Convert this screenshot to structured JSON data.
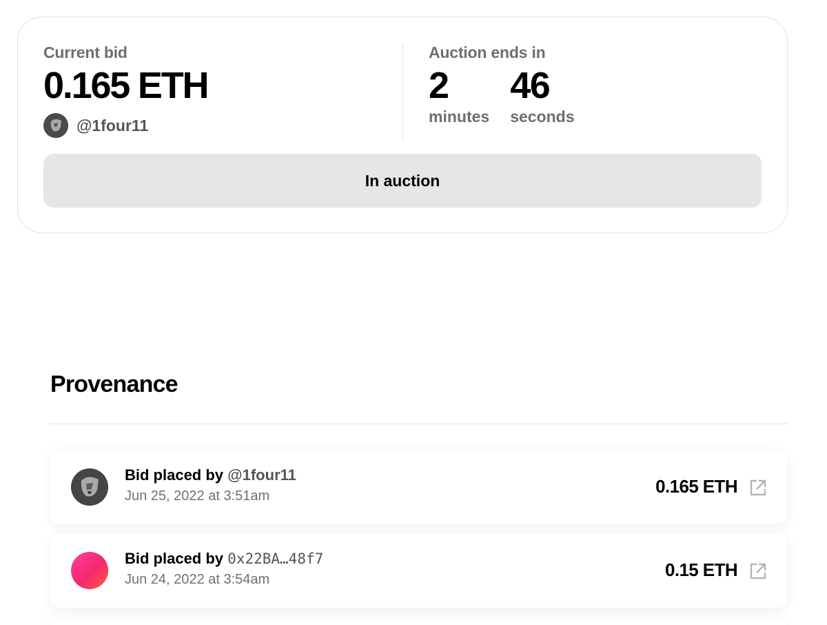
{
  "auction": {
    "current_bid_label": "Current bid",
    "current_bid_value": "0.165 ETH",
    "bidder_handle": "@1four11",
    "ends_label": "Auction ends in",
    "minutes_value": "2",
    "minutes_label": "minutes",
    "seconds_value": "46",
    "seconds_label": "seconds",
    "status_label": "In auction"
  },
  "provenance": {
    "title": "Provenance",
    "items": [
      {
        "prefix": "Bid placed by",
        "bidder": "@1four11",
        "date": "Jun 25, 2022 at 3:51am",
        "amount": "0.165 ETH",
        "avatar": "grayscale-portrait"
      },
      {
        "prefix": "Bid placed by",
        "bidder": "0x22BA…48f7",
        "date": "Jun 24, 2022 at 3:54am",
        "amount": "0.15 ETH",
        "avatar": "pink-gradient"
      }
    ]
  },
  "colors": {
    "muted_text": "#6e6e6e",
    "button_bg": "#e6e6e6",
    "pink_avatar": "#f4286e"
  },
  "icons": [
    "external-link-icon"
  ]
}
